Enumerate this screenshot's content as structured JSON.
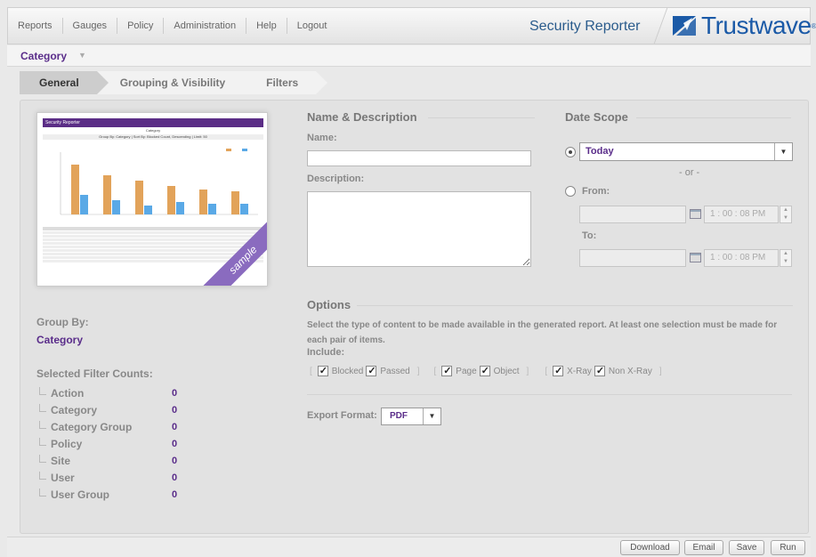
{
  "nav": {
    "items": [
      "Reports",
      "Gauges",
      "Policy",
      "Administration",
      "Help",
      "Logout"
    ],
    "app_title": "Security Reporter",
    "brand": "Trustwave"
  },
  "category": {
    "title": "Category"
  },
  "tabs": [
    {
      "label": "General"
    },
    {
      "label": "Grouping & Visibility"
    },
    {
      "label": "Filters"
    }
  ],
  "thumbnail": {
    "header": "Security Reporter",
    "subheader": "Category",
    "caption": "Group By: Category | Sort By: Blocked Count, Descending | Limit: 50",
    "badge": "sample"
  },
  "left": {
    "group_by_label": "Group By:",
    "group_by_value": "Category",
    "filter_counts_label": "Selected Filter Counts:",
    "filter_counts": [
      {
        "name": "Action",
        "count": "0"
      },
      {
        "name": "Category",
        "count": "0"
      },
      {
        "name": "Category Group",
        "count": "0"
      },
      {
        "name": "Policy",
        "count": "0"
      },
      {
        "name": "Site",
        "count": "0"
      },
      {
        "name": "User",
        "count": "0"
      },
      {
        "name": "User Group",
        "count": "0"
      }
    ]
  },
  "name_desc": {
    "title": "Name & Description",
    "name_label": "Name:",
    "name_value": "",
    "description_label": "Description:",
    "description_value": ""
  },
  "date_scope": {
    "title": "Date Scope",
    "selected": "Today",
    "or": "- or -",
    "from_label": "From:",
    "to_label": "To:",
    "from_time": "1 : 00 : 08 PM",
    "to_time": "1 : 00 : 08 PM"
  },
  "options": {
    "title": "Options",
    "description": "Select the type of content to be made available in the generated report. At least one selection must be made for each pair of items.",
    "include_label": "Include:",
    "checkboxes": [
      "Blocked",
      "Passed",
      "Page",
      "Object",
      "X-Ray",
      "Non X-Ray"
    ],
    "checked": [
      true,
      true,
      true,
      true,
      true,
      true
    ],
    "export_label": "Export Format:",
    "export_value": "PDF"
  },
  "buttons": {
    "download": "Download",
    "email": "Email",
    "save": "Save",
    "run": "Run"
  },
  "colors": {
    "accent": "#5a2d8a",
    "brand": "#1b5aa7"
  }
}
